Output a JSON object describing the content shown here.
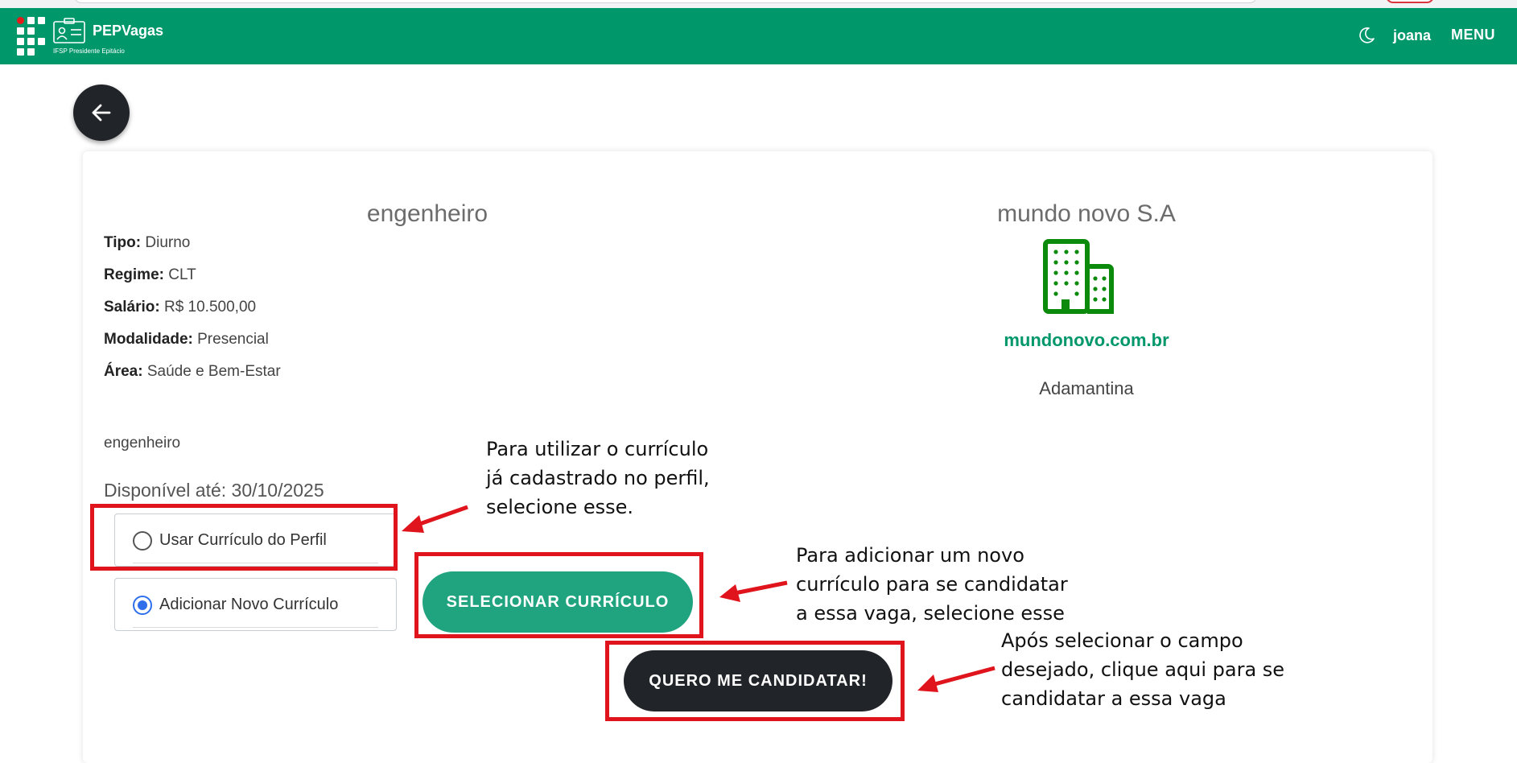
{
  "navbar": {
    "brand_name": "PEPVagas",
    "brand_subtitle": "IFSP Presidente Epitácio",
    "user_name": "joana",
    "menu_label": "MENU",
    "icons": [
      "ifsp-logo-icon",
      "id-card-icon",
      "moon-icon"
    ],
    "bar_color": "#00976b"
  },
  "job": {
    "title": "engenheiro",
    "details": [
      {
        "label": "Tipo:",
        "value": "Diurno"
      },
      {
        "label": "Regime:",
        "value": "CLT"
      },
      {
        "label": "Salário:",
        "value": "R$ 10.500,00"
      },
      {
        "label": "Modalidade:",
        "value": "Presencial"
      },
      {
        "label": "Área:",
        "value": "Saúde e Bem-Estar"
      }
    ],
    "description": "engenheiro",
    "deadline": "Disponível até: 30/10/2025"
  },
  "company": {
    "name": "mundo novo S.A",
    "icon": "building-icon",
    "website": "mundonovo.com.br",
    "city": "Adamantina"
  },
  "resume_options": [
    {
      "label": "Usar Currículo do Perfil",
      "checked": false
    },
    {
      "label": "Adicionar Novo Currículo",
      "checked": true
    }
  ],
  "buttons": {
    "select_resume": "SELECIONAR CURRÍCULO",
    "apply": "QUERO ME CANDIDATAR!"
  },
  "annotations": {
    "profile_resume": "Para utilizar o currículo\njá cadastrado no perfil,\nselecione esse.",
    "new_resume": "Para adicionar um novo\ncurrículo para se candidatar\na essa vaga, selecione esse",
    "apply": "Após selecionar o campo\ndesejado, clique aqui para se\ncandidatar a essa vaga",
    "highlight_color": "#e0141c"
  }
}
